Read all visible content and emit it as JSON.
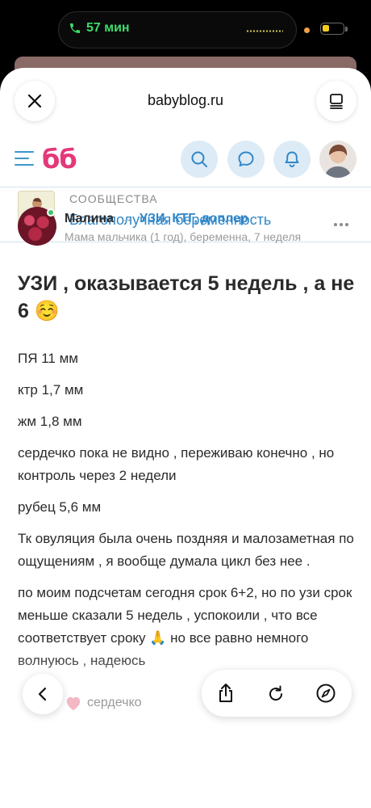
{
  "status_bar": {
    "call_timer": "57 мин",
    "battery_level": 0.35,
    "call_icon": "phone-icon"
  },
  "browser": {
    "url": "babyblog.ru",
    "close_icon": "close-icon",
    "tabs_icon": "tabs-icon",
    "toolbar_icons": [
      "chevron-left-icon",
      "share-icon",
      "reload-icon",
      "compass-icon"
    ]
  },
  "site": {
    "logo": "бб",
    "brand_color": "#e4387a",
    "accent_color": "#2f86c8",
    "header_icons": [
      "menu-icon",
      "search-icon",
      "chat-icon",
      "bell-icon",
      "user-avatar"
    ]
  },
  "community": {
    "label": "СООБЩЕСТВА",
    "name": "Благополучная беременность"
  },
  "post": {
    "author": "Малина",
    "rubric": "УЗИ, КТГ, доплер",
    "author_status": "Мама мальчика (1 год), беременна, 7 неделя",
    "title": "УЗИ , оказывается 5 недель , а не 6 ☺️",
    "paragraphs": [
      "ПЯ 11 мм",
      "ктр 1,7 мм",
      "жм 1,8 мм",
      "сердечко пока не видно , переживаю конечно , но контроль через 2 недели",
      "рубец 5,6 мм",
      "Тк овуляция была очень поздняя и малозаметная по ощущениям , я вообще думала цикл без нее .",
      "по моим подсчетам сегодня срок 6+2, но по узи срок меньше сказали 5 недель , успокоили , что все соответствует сроку 🙏 но все равно немного волнуюсь , надеюсь"
    ],
    "like_label": "сердечко"
  }
}
